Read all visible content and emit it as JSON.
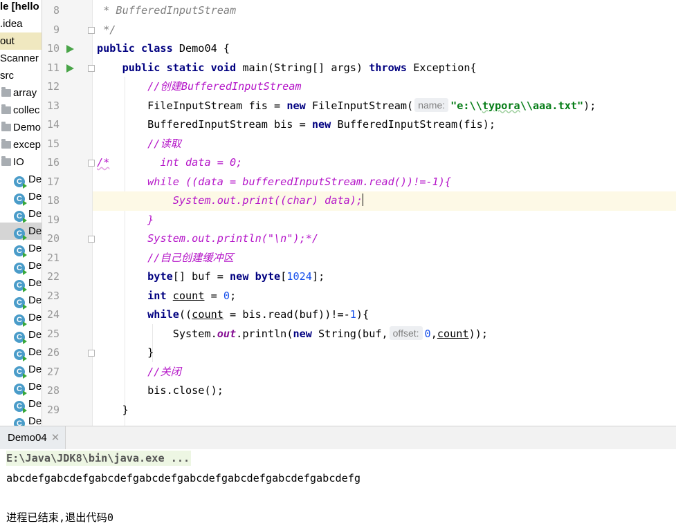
{
  "project_tree": {
    "items": [
      {
        "label": "le [hello",
        "bold": true
      },
      {
        "label": ".idea"
      },
      {
        "label": "out",
        "selected": true
      },
      {
        "label": "Scanner"
      },
      {
        "label": "src"
      },
      {
        "label": "array",
        "folder": true
      },
      {
        "label": "collec",
        "folder": true
      },
      {
        "label": "Demo",
        "folder": true
      },
      {
        "label": "excep",
        "folder": true
      },
      {
        "label": "IO",
        "folder": true
      },
      {
        "label": "De",
        "class": true
      },
      {
        "label": "De",
        "class": true
      },
      {
        "label": "De",
        "class": true
      },
      {
        "label": "De",
        "class": true,
        "highlighted": true
      },
      {
        "label": "De",
        "class": true
      },
      {
        "label": "De",
        "class": true
      },
      {
        "label": "De",
        "class": true
      },
      {
        "label": "De",
        "class": true
      },
      {
        "label": "De",
        "class": true
      },
      {
        "label": "De",
        "class": true
      },
      {
        "label": "De",
        "class": true
      },
      {
        "label": "De",
        "class": true
      },
      {
        "label": "De",
        "class": true
      },
      {
        "label": "De",
        "class": true
      },
      {
        "label": "De",
        "class": true
      }
    ],
    "class_icon_letter": "C"
  },
  "editor": {
    "line_numbers": [
      "8",
      "9",
      "10",
      "11",
      "12",
      "13",
      "14",
      "15",
      "16",
      "17",
      "18",
      "19",
      "20",
      "21",
      "22",
      "23",
      "24",
      "25",
      "26",
      "27",
      "28",
      "29"
    ],
    "run_gutter_lines": [
      "10",
      "11"
    ],
    "current_line": "18",
    "lines": {
      "l8": {
        "a": " * BufferedInputStream"
      },
      "l9": {
        "a": " */"
      },
      "l10": {
        "a": "public class",
        "b": " Demo04 {"
      },
      "l11": {
        "a": "    ",
        "b": "public static void",
        "c": " main(String[] args) ",
        "d": "throws",
        "e": " Exception{"
      },
      "l12": {
        "a": "        ",
        "b": "//创建BufferedInputStream"
      },
      "l13": {
        "a": "        FileInputStream fis = ",
        "b": "new",
        "c": " FileInputStream(",
        "hint": "name:",
        "s1": "\"e:\\\\",
        "s2": "typora",
        "s3": "\\\\aaa.txt\"",
        "d": ");"
      },
      "l14": {
        "a": "        BufferedInputStream bis = ",
        "b": "new",
        "c": " BufferedInputStream(fis);"
      },
      "l15": {
        "a": "        ",
        "b": "//读取"
      },
      "l16": {
        "a": "/*",
        "b": "        int data = 0;"
      },
      "l17": {
        "a": "        ",
        "b": "while ((data = bufferedInputStream.read())!=-1){"
      },
      "l18": {
        "a": "            ",
        "b": "System.out.print((char) data);"
      },
      "l19": {
        "a": "        ",
        "b": "}"
      },
      "l20": {
        "a": "        ",
        "b": "System.out.println(\"\\n\");*/"
      },
      "l21": {
        "a": "        ",
        "b": "//自己创建缓冲区"
      },
      "l22": {
        "a": "        ",
        "b": "byte",
        "c": "[] buf = ",
        "d": "new",
        "e": " ",
        "f": "byte",
        "g": "[",
        "h": "1024",
        "i": "];"
      },
      "l23": {
        "a": "        ",
        "b": "int",
        "c": " ",
        "d": "count",
        "e": " = ",
        "f": "0",
        "g": ";"
      },
      "l24": {
        "a": "        ",
        "b": "while",
        "c": "((",
        "d": "count",
        "e": " = bis.read(buf))!=-",
        "f": "1",
        "g": "){"
      },
      "l25": {
        "a": "            System.",
        "b": "out",
        "c": ".println(",
        "d": "new",
        "e": " String(buf,",
        "hint": "offset:",
        "f": "0",
        "g": ",",
        "h": "count",
        "i": "));"
      },
      "l26": {
        "a": "        }"
      },
      "l27": {
        "a": "        ",
        "b": "//关闭"
      },
      "l28": {
        "a": "        bis.close();"
      },
      "l29": {
        "a": "    }"
      }
    }
  },
  "run_panel": {
    "tab_label": "Demo04",
    "close_label": "✕"
  },
  "console": {
    "command": "E:\\Java\\JDK8\\bin\\java.exe ...",
    "output": "abcdefgabcdefgabcdefgabcdefgabcdefgabcdefgabcdefgabcdefg",
    "exit_message": "进程已结束,退出代码0"
  },
  "colors": {
    "keyword": "#000080",
    "comment_zh": "#b414c8",
    "string": "#067d17",
    "number": "#1750eb",
    "current_line_bg": "#fdf9e6",
    "run_icon": "#49a448"
  }
}
